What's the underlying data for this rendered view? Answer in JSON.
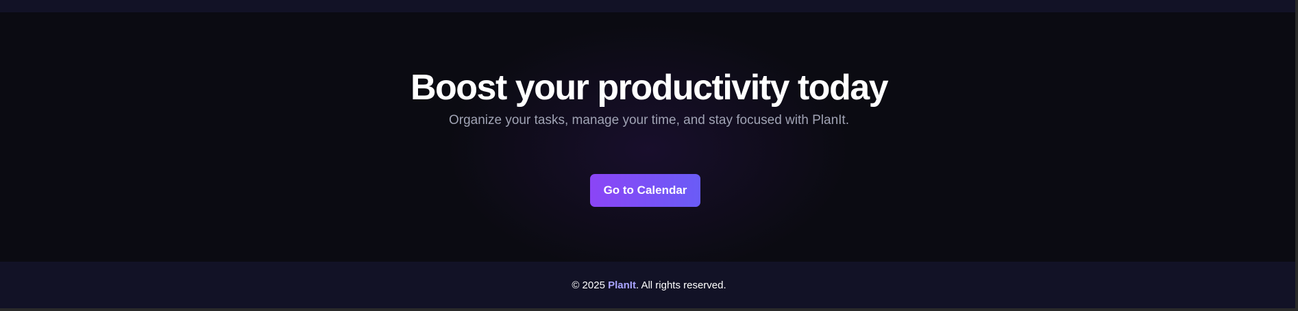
{
  "hero": {
    "title": "Boost your productivity today",
    "subtitle": "Organize your tasks, manage your time, and stay focused with PlanIt.",
    "cta_label": "Go to Calendar"
  },
  "footer": {
    "copyright_prefix": "© 2025 ",
    "brand": "PlanIt",
    "copyright_suffix": ". All rights reserved."
  },
  "colors": {
    "background": "#0b0b12",
    "footer_background": "#121226",
    "button_gradient_start": "#8b45f6",
    "button_gradient_end": "#6a5cf6",
    "brand_accent": "#a9a4ff",
    "subtitle_text": "#a0a3b4"
  }
}
